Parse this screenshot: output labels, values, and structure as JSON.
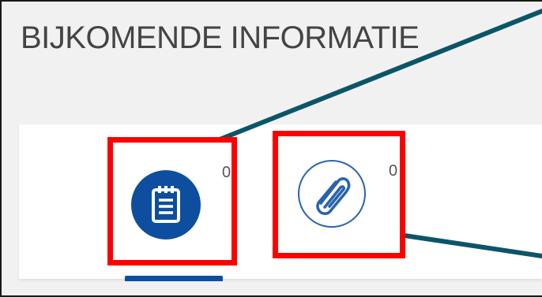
{
  "section": {
    "title": "BIJKOMENDE INFORMATIE"
  },
  "tabs": [
    {
      "name": "notes",
      "icon": "notepad-icon",
      "count": "0",
      "active": true
    },
    {
      "name": "attachments",
      "icon": "paperclip-icon",
      "count": "0",
      "active": false
    }
  ],
  "colors": {
    "primary": "#0d4f9e",
    "highlight": "#ff0000",
    "callout_line": "#0b5568"
  }
}
